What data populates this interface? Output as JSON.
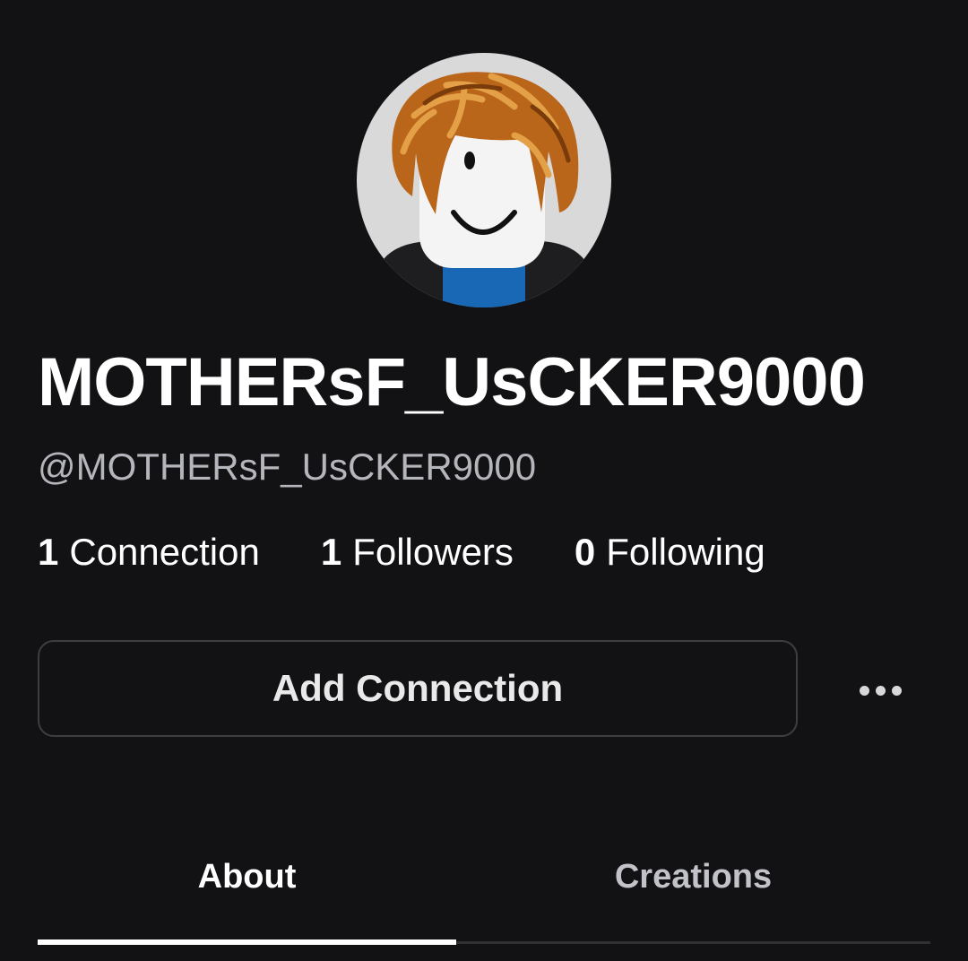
{
  "profile": {
    "display_name": "MOTHERsF_UsCKER9000",
    "username": "@MOTHERsF_UsCKER9000",
    "avatar_icon": "roblox-bacon-hair-avatar"
  },
  "stats": {
    "connections": {
      "count": "1",
      "label": "Connection"
    },
    "followers": {
      "count": "1",
      "label": "Followers"
    },
    "following": {
      "count": "0",
      "label": "Following"
    }
  },
  "actions": {
    "add_connection_label": "Add Connection",
    "more_icon": "ellipsis-icon"
  },
  "tabs": [
    {
      "label": "About",
      "active": true
    },
    {
      "label": "Creations",
      "active": false
    }
  ],
  "colors": {
    "background": "#121215",
    "muted_text": "#b5b6bb",
    "button_border": "#3d3e42",
    "active_tab_indicator": "#ffffff"
  }
}
